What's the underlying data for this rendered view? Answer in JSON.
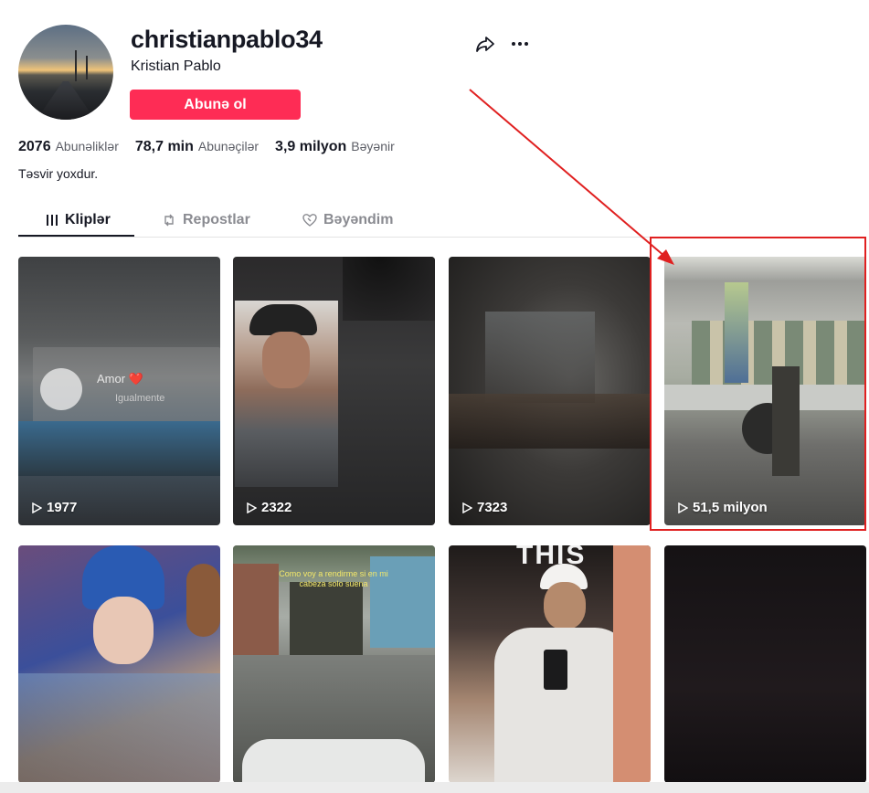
{
  "profile": {
    "username": "christianpablo34",
    "nickname": "Kristian Pablo",
    "follow_label": "Abunə ol",
    "bio": "Təsvir yoxdur."
  },
  "stats": [
    {
      "value": "2076",
      "label": "Abunəliklər"
    },
    {
      "value": "78,7 min",
      "label": "Abunəçilər"
    },
    {
      "value": "3,9 milyon",
      "label": "Bəyənir"
    }
  ],
  "tabs": [
    {
      "label": "Kliplər",
      "icon": "grid-icon",
      "active": true
    },
    {
      "label": "Repostlar",
      "icon": "repost-icon",
      "active": false
    },
    {
      "label": "Bəyəndim",
      "icon": "heart-icon",
      "active": false
    }
  ],
  "videos": [
    {
      "views": "1977",
      "overlay_text": "Amor ❤️",
      "overlay_sub": "Igualmente"
    },
    {
      "views": "2322"
    },
    {
      "views": "7323"
    },
    {
      "views": "51,5 milyon"
    },
    {
      "views": ""
    },
    {
      "views": "",
      "overlay_text": "Como voy a rendirme si en mi cabeza solo suena"
    },
    {
      "views": "",
      "overlay_text": "THIS"
    },
    {
      "views": ""
    }
  ],
  "colors": {
    "accent": "#fe2c55",
    "annotation": "#e02020"
  }
}
